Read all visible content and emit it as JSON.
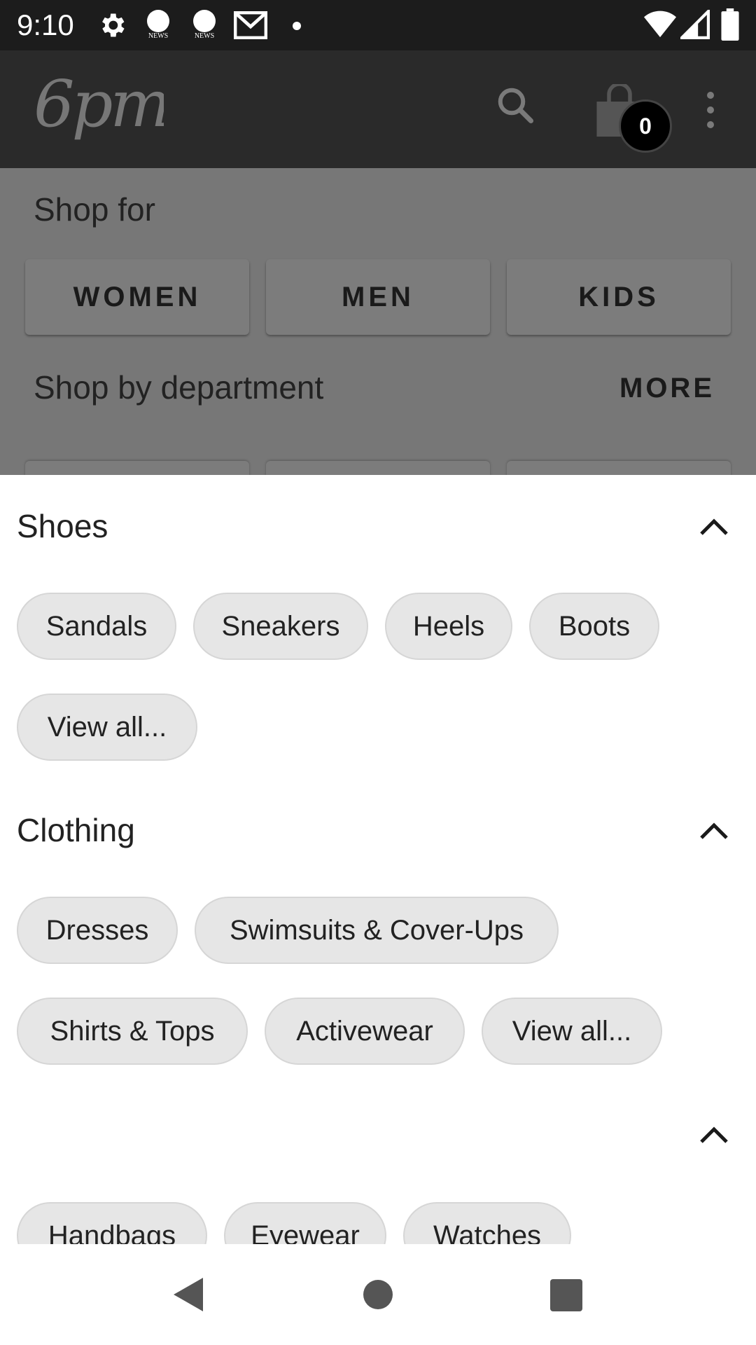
{
  "status_bar": {
    "time": "9:10",
    "icons": [
      "gear-icon",
      "abc-news-icon",
      "abc-news-icon",
      "gmail-icon",
      "dot-icon",
      "wifi-icon",
      "signal-icon",
      "battery-icon"
    ],
    "news_label": "NEWS"
  },
  "app_bar": {
    "logo_text": "6pm",
    "cart_count": "0",
    "icons": [
      "search-icon",
      "shopping-bag-icon",
      "more-vert-icon"
    ]
  },
  "background_page": {
    "shop_for_title": "Shop for",
    "gender_buttons": [
      "WOMEN",
      "MEN",
      "KIDS"
    ],
    "department_title": "Shop by department",
    "more_label": "MORE"
  },
  "sheet": {
    "sections": [
      {
        "title": "Shoes",
        "chips": [
          "Sandals",
          "Sneakers",
          "Heels",
          "Boots",
          "View all..."
        ]
      },
      {
        "title": "Clothing",
        "chips": [
          "Dresses",
          "Swimsuits & Cover-Ups",
          "Shirts & Tops",
          "Activewear",
          "View all..."
        ]
      },
      {
        "title": "",
        "chips": [
          "Handbags",
          "Eyewear",
          "Watches"
        ]
      }
    ]
  },
  "colors": {
    "status_bar": "#1c1c1c",
    "app_bar": "#2a2a2a",
    "scrim": "#777777",
    "chip_bg": "#e6e6e6",
    "text": "#222222"
  },
  "nav_bar": {
    "icons": [
      "back-icon",
      "home-icon",
      "recents-icon"
    ]
  }
}
